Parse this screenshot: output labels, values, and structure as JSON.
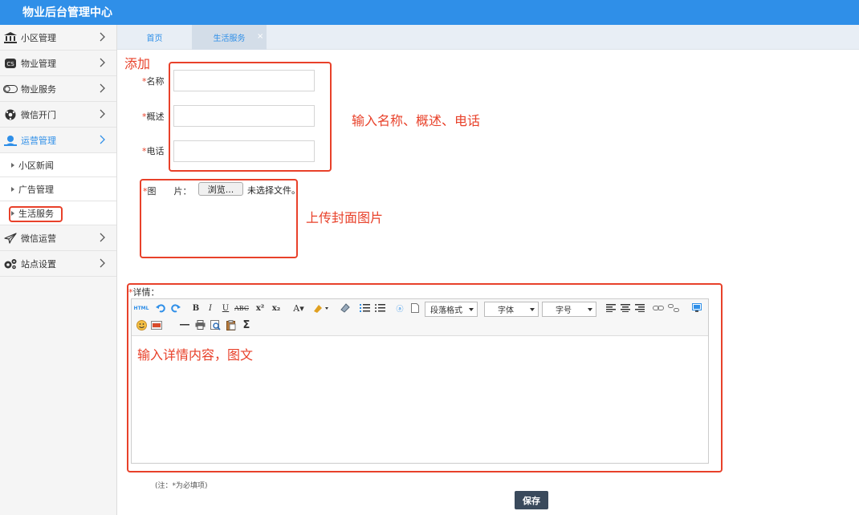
{
  "header": {
    "title": "物业后台管理中心",
    "bg_color": "#2f8fe8"
  },
  "sidebar": {
    "items": [
      {
        "label": "小区管理",
        "icon": "bank-icon"
      },
      {
        "label": "物业管理",
        "icon": "cs-icon"
      },
      {
        "label": "物业服务",
        "icon": "toggle-icon"
      },
      {
        "label": "微信开门",
        "icon": "soccer-ball-icon"
      },
      {
        "label": "运营管理",
        "icon": "operator-icon",
        "active": true
      }
    ],
    "sub_items": [
      {
        "label": "小区新闻"
      },
      {
        "label": "广告管理"
      },
      {
        "label": "生活服务",
        "highlighted": true
      }
    ],
    "items_after": [
      {
        "label": "微信运营",
        "icon": "paper-plane-icon"
      },
      {
        "label": "站点设置",
        "icon": "gears-icon"
      }
    ]
  },
  "tabs": [
    {
      "label": "首页"
    },
    {
      "label": "生活服务",
      "active": true
    }
  ],
  "tab_close": "×",
  "form": {
    "required_mark": "*",
    "add_note": "添加",
    "name_label": "名称",
    "name_value": "",
    "summary_label": "概述",
    "summary_value": "",
    "phone_label": "电话",
    "phone_value": "",
    "fields_note": "输入名称、概述、电话",
    "image_label": "图　　片：",
    "browse_button": "浏览...",
    "file_status": "未选择文件。",
    "image_note": "上传封面图片",
    "detail_label": "详情：",
    "editor_note": "输入详情内容，图文",
    "editor_selects": [
      "段落格式",
      "字体",
      "字号"
    ],
    "required_hint": "(注：*为必填项)",
    "save_button": "保存"
  },
  "colors": {
    "annotation": "#e8412a",
    "accent": "#2f8fe8",
    "save_button": "#3a4a5c"
  }
}
